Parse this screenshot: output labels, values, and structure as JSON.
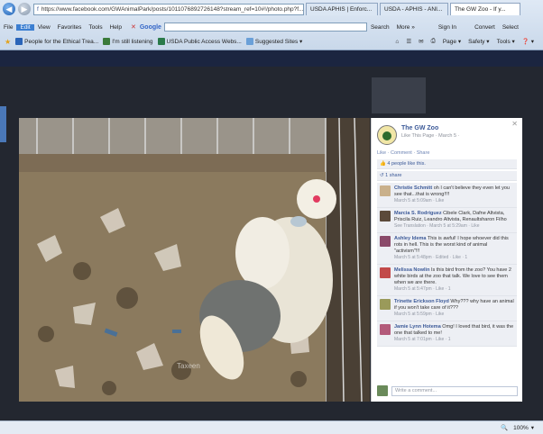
{
  "browser": {
    "url": "https://www.facebook.com/GWAnimalPark/posts/1011076892726148?stream_ref=10#!/photo.php?f...",
    "tabs": [
      {
        "label": "USDA APHIS | Enforc...",
        "active": false
      },
      {
        "label": "USDA - APHIS - ANI...",
        "active": false
      },
      {
        "label": "The GW Zoo - If y...",
        "active": true
      }
    ],
    "menu": [
      "File",
      "Edit",
      "View",
      "Favorites",
      "Tools",
      "Help"
    ],
    "search_engine": "Google",
    "toolbar": {
      "search": "Search",
      "more": "More »",
      "sign_in": "Sign In",
      "convert": "Convert",
      "select": "Select"
    },
    "favorites": [
      "People for the Ethical Trea...",
      "I'm still listening",
      "USDA Public Access Webs...",
      "Suggested Sites ▾"
    ],
    "command_bar": [
      "Page ▾",
      "Safety ▾",
      "Tools ▾",
      "❓ ▾"
    ],
    "zoom": "100%"
  },
  "panel": {
    "page_name": "The GW Zoo",
    "page_meta": "Like This Page · March 5 ·",
    "actions": "Like · Comment · Share",
    "likes_text": "4 people like this.",
    "shares_text": "1 share",
    "comments": [
      {
        "name": "Christie Schmitt",
        "text": "oh I can't believe they even let you see that...that is wrong!!!!",
        "meta": "March 5 at 5:09am · Like",
        "color": "#c9b08b"
      },
      {
        "name": "Marcia S. Rodriguez",
        "text": "Cibele Clark, Dafne Altvista, Priscila Ruiz, Leandro Altvista, Renaultsharon Filho",
        "meta": "See Translation · March 5 at 5:29am · Like",
        "color": "#5c4a3a"
      },
      {
        "name": "Ashley Idema",
        "text": "This is awful! I hope whoever did this rots in hell. This is the worst kind of animal \"activism\"!!!",
        "meta": "March 5 at 5:48pm · Edited · Like · 1",
        "color": "#8a4a6a"
      },
      {
        "name": "Melissa Nowlin",
        "text": "Is this bird from the zoo? You have 2 white birds at the zoo that talk. We love to see them when we are there.",
        "meta": "March 5 at 5:47pm · Like · 1",
        "color": "#c24a4a"
      },
      {
        "name": "Trinette Erickson Floyd",
        "text": "Why??? why have an animal if you won't take care of it???",
        "meta": "March 5 at 5:59pm · Like",
        "color": "#9a9a5a"
      },
      {
        "name": "Jamie Lynn Hotema",
        "text": "Omg! I loved that bird, it was the one that talked to me!",
        "meta": "March 5 at 7:01pm · Like · 1",
        "color": "#b35a7a"
      }
    ],
    "write_placeholder": "Write a comment..."
  }
}
